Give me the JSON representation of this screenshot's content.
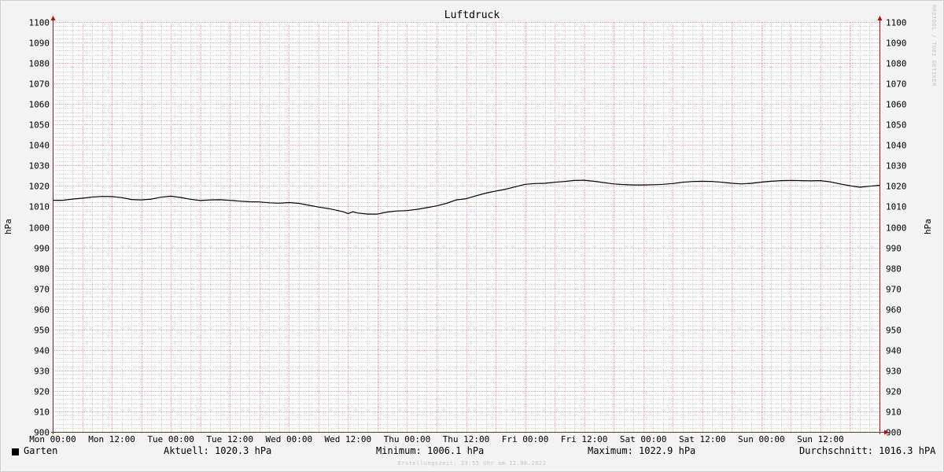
{
  "colors": {
    "background": "#f3f3f3",
    "plot_background": "#ffffff",
    "minor_grid": "#d2d2d2",
    "major_grid": "#e8a0a0",
    "axis": "#b01010",
    "line": "#000000",
    "text": "#000000"
  },
  "chart_data": {
    "type": "line",
    "title": "Luftdruck",
    "ylabel": "hPa",
    "ylim": [
      900,
      1100
    ],
    "ytick_step": 10,
    "y_minor_step": 2,
    "yticks": [
      "1100",
      "1090",
      "1080",
      "1070",
      "1060",
      "1050",
      "1040",
      "1030",
      "1020",
      "1010",
      "1000",
      "990",
      "980",
      "970",
      "960",
      "950",
      "940",
      "930",
      "920",
      "910",
      "900"
    ],
    "x_unit": "hours since first tick",
    "xlim": [
      0,
      168
    ],
    "x_minor_step_hours": 2,
    "x_major_step_hours": 6,
    "xticks": [
      {
        "label": "Mon 00:00",
        "hour": 0
      },
      {
        "label": "Mon 12:00",
        "hour": 12
      },
      {
        "label": "Tue 00:00",
        "hour": 24
      },
      {
        "label": "Tue 12:00",
        "hour": 36
      },
      {
        "label": "Wed 00:00",
        "hour": 48
      },
      {
        "label": "Wed 12:00",
        "hour": 60
      },
      {
        "label": "Thu 00:00",
        "hour": 72
      },
      {
        "label": "Thu 12:00",
        "hour": 84
      },
      {
        "label": "Fri 00:00",
        "hour": 96
      },
      {
        "label": "Fri 12:00",
        "hour": 108
      },
      {
        "label": "Sat 00:00",
        "hour": 120
      },
      {
        "label": "Sat 12:00",
        "hour": 132
      },
      {
        "label": "Sun 00:00",
        "hour": 144
      },
      {
        "label": "Sun 12:00",
        "hour": 156
      }
    ],
    "grid": true,
    "series": [
      {
        "name": "Garten",
        "color": "#000000",
        "x": [
          0,
          2,
          4,
          6,
          8,
          10,
          12,
          14,
          16,
          18,
          20,
          22,
          24,
          26,
          28,
          30,
          32,
          34,
          36,
          38,
          40,
          42,
          44,
          46,
          48,
          50,
          52,
          54,
          56,
          58,
          59,
          60,
          61,
          62,
          64,
          66,
          68,
          70,
          72,
          74,
          76,
          78,
          80,
          82,
          84,
          86,
          88,
          90,
          92,
          94,
          96,
          98,
          100,
          102,
          104,
          106,
          108,
          110,
          112,
          114,
          116,
          118,
          120,
          122,
          124,
          126,
          128,
          130,
          132,
          134,
          136,
          138,
          140,
          142,
          144,
          146,
          148,
          150,
          152,
          154,
          156,
          158,
          160,
          162,
          164,
          166,
          168
        ],
        "values": [
          1013.0,
          1013.0,
          1013.6,
          1014.0,
          1014.6,
          1014.9,
          1014.8,
          1014.3,
          1013.4,
          1013.2,
          1013.6,
          1014.5,
          1015.0,
          1014.4,
          1013.5,
          1012.9,
          1013.2,
          1013.3,
          1013.0,
          1012.6,
          1012.3,
          1012.2,
          1011.8,
          1011.6,
          1011.9,
          1011.5,
          1010.6,
          1009.7,
          1009.0,
          1008.0,
          1007.4,
          1006.5,
          1007.4,
          1006.8,
          1006.3,
          1006.3,
          1007.3,
          1007.8,
          1008.0,
          1008.6,
          1009.4,
          1010.3,
          1011.5,
          1013.2,
          1013.8,
          1015.2,
          1016.5,
          1017.5,
          1018.4,
          1019.6,
          1020.8,
          1021.2,
          1021.3,
          1021.8,
          1022.2,
          1022.7,
          1022.8,
          1022.3,
          1021.6,
          1021.0,
          1020.7,
          1020.5,
          1020.5,
          1020.6,
          1020.8,
          1021.2,
          1021.8,
          1022.2,
          1022.3,
          1022.2,
          1021.8,
          1021.3,
          1021.0,
          1021.3,
          1021.9,
          1022.3,
          1022.6,
          1022.7,
          1022.6,
          1022.5,
          1022.6,
          1022.0,
          1021.0,
          1020.1,
          1019.4,
          1019.9,
          1020.3
        ]
      }
    ],
    "legend": "bottom-left"
  },
  "footer": {
    "legend_name": "Garten",
    "current": "Aktuell: 1020.3 hPa",
    "minimum": "Minimum: 1006.1 hPa",
    "maximum": "Maximum: 1022.9 hPa",
    "average": "Durchschnitt: 1016.3 hPA",
    "created": "Erstellungszeit: 23:55 Uhr am 12.06.2022",
    "watermark": "RRDTOOL / TOBI OETIKER"
  }
}
